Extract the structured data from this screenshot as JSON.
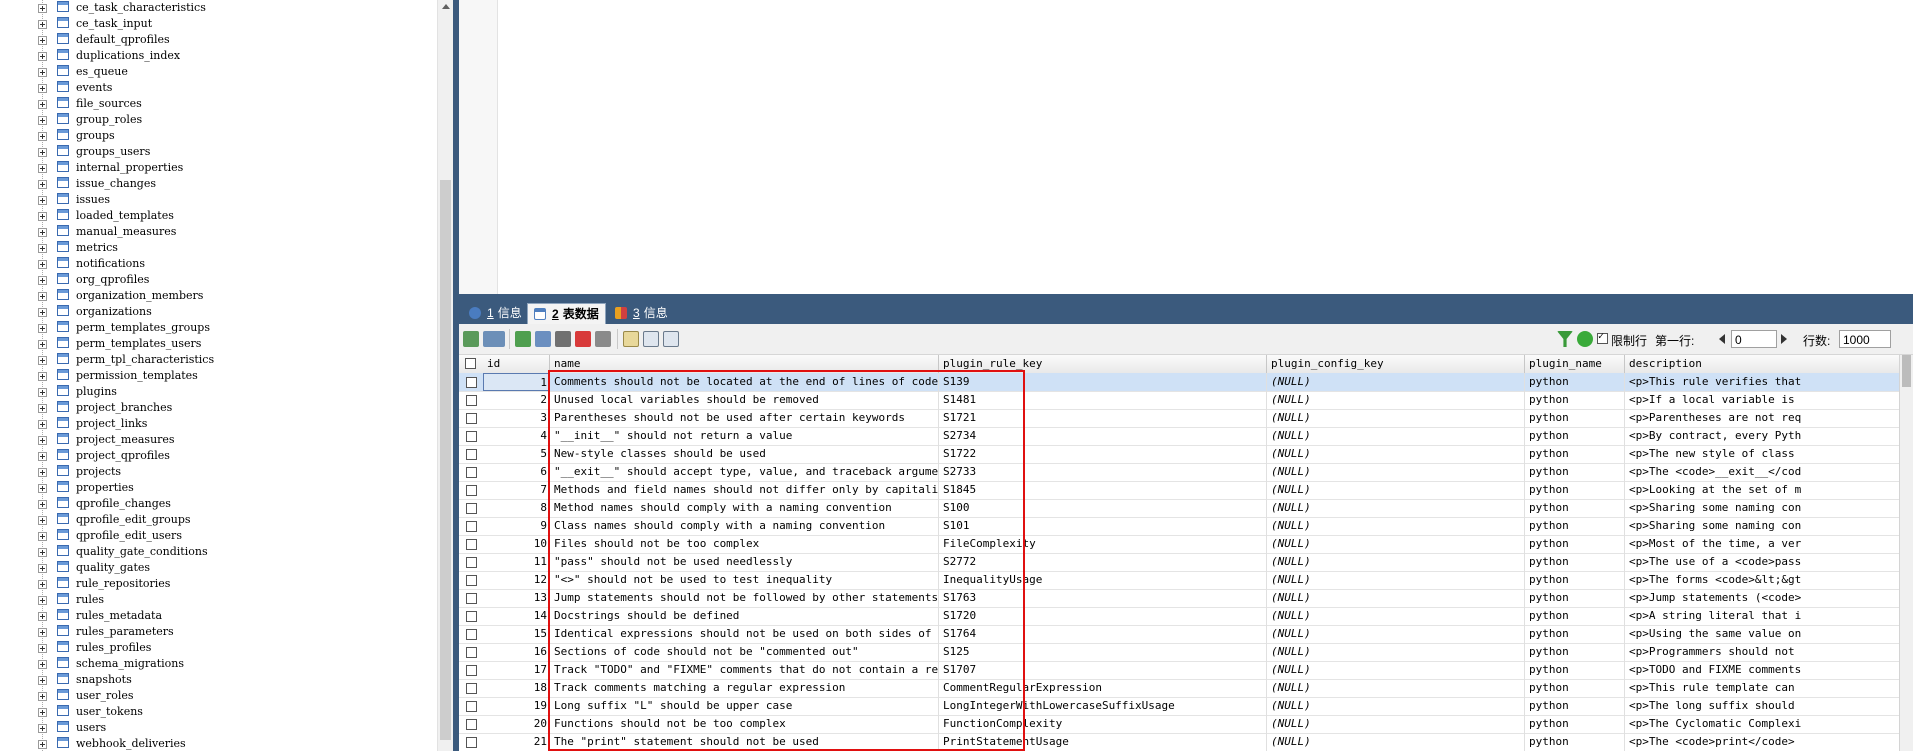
{
  "tree": {
    "items": [
      "ce_task_characteristics",
      "ce_task_input",
      "default_qprofiles",
      "duplications_index",
      "es_queue",
      "events",
      "file_sources",
      "group_roles",
      "groups",
      "groups_users",
      "internal_properties",
      "issue_changes",
      "issues",
      "loaded_templates",
      "manual_measures",
      "metrics",
      "notifications",
      "org_qprofiles",
      "organization_members",
      "organizations",
      "perm_templates_groups",
      "perm_templates_users",
      "perm_tpl_characteristics",
      "permission_templates",
      "plugins",
      "project_branches",
      "project_links",
      "project_measures",
      "project_qprofiles",
      "projects",
      "properties",
      "qprofile_changes",
      "qprofile_edit_groups",
      "qprofile_edit_users",
      "quality_gate_conditions",
      "quality_gates",
      "rule_repositories",
      "rules",
      "rules_metadata",
      "rules_parameters",
      "rules_profiles",
      "schema_migrations",
      "snapshots",
      "user_roles",
      "user_tokens",
      "users",
      "webhook_deliveries"
    ]
  },
  "tabs": [
    {
      "num": "1",
      "label": "信息",
      "active": false
    },
    {
      "num": "2",
      "label": "表数据",
      "active": true
    },
    {
      "num": "3",
      "label": "信息",
      "active": false
    }
  ],
  "toolbar": {
    "limit_label": "限制行",
    "first_row_label": "第一行:",
    "first_row_value": "0",
    "rows_label": "行数:",
    "rows_value": "1000"
  },
  "grid": {
    "columns": [
      "id",
      "name",
      "plugin_rule_key",
      "plugin_config_key",
      "plugin_name",
      "description"
    ],
    "rows": [
      {
        "id": "1",
        "name": "Comments should not be located at the end of lines of code",
        "key": "S139",
        "config": "(NULL)",
        "plugin": "python",
        "desc": "<p>This rule verifies that"
      },
      {
        "id": "2",
        "name": "Unused local variables should be removed",
        "key": "S1481",
        "config": "(NULL)",
        "plugin": "python",
        "desc": "<p>If a local variable is"
      },
      {
        "id": "3",
        "name": "Parentheses should not be used after certain keywords",
        "key": "S1721",
        "config": "(NULL)",
        "plugin": "python",
        "desc": "<p>Parentheses are not req"
      },
      {
        "id": "4",
        "name": "\"__init__\" should not return a value",
        "key": "S2734",
        "config": "(NULL)",
        "plugin": "python",
        "desc": "<p>By contract, every Pyth"
      },
      {
        "id": "5",
        "name": "New-style classes should be used",
        "key": "S1722",
        "config": "(NULL)",
        "plugin": "python",
        "desc": "<p>The new style of class"
      },
      {
        "id": "6",
        "name": "\"__exit__\" should accept type, value, and traceback arguments",
        "key": "S2733",
        "config": "(NULL)",
        "plugin": "python",
        "desc": "<p>The <code>__exit__</cod"
      },
      {
        "id": "7",
        "name": "Methods and field names should not differ only by capitalization",
        "key": "S1845",
        "config": "(NULL)",
        "plugin": "python",
        "desc": "<p>Looking at the set of m"
      },
      {
        "id": "8",
        "name": "Method names should comply with a naming convention",
        "key": "S100",
        "config": "(NULL)",
        "plugin": "python",
        "desc": "<p>Sharing some naming con"
      },
      {
        "id": "9",
        "name": "Class names should comply with a naming convention",
        "key": "S101",
        "config": "(NULL)",
        "plugin": "python",
        "desc": "<p>Sharing some naming con"
      },
      {
        "id": "10",
        "name": "Files should not be too complex",
        "key": "FileComplexity",
        "config": "(NULL)",
        "plugin": "python",
        "desc": "<p>Most of the time, a ver"
      },
      {
        "id": "11",
        "name": "\"pass\" should not be used needlessly",
        "key": "S2772",
        "config": "(NULL)",
        "plugin": "python",
        "desc": "<p>The use of a <code>pass"
      },
      {
        "id": "12",
        "name": "\"<>\" should not be used to test inequality",
        "key": "InequalityUsage",
        "config": "(NULL)",
        "plugin": "python",
        "desc": "<p>The forms <code>&lt;&gt"
      },
      {
        "id": "13",
        "name": "Jump statements should not be followed by other statements",
        "key": "S1763",
        "config": "(NULL)",
        "plugin": "python",
        "desc": "<p>Jump statements (<code>"
      },
      {
        "id": "14",
        "name": "Docstrings should be defined",
        "key": "S1720",
        "config": "(NULL)",
        "plugin": "python",
        "desc": "<p>A string literal that i"
      },
      {
        "id": "15",
        "name": "Identical expressions should not be used on both sides of a binary",
        "key": "S1764",
        "config": "(NULL)",
        "plugin": "python",
        "desc": "<p>Using the same value on"
      },
      {
        "id": "16",
        "name": "Sections of code should not be \"commented out\"",
        "key": "S125",
        "config": "(NULL)",
        "plugin": "python",
        "desc": "<p>Programmers should not"
      },
      {
        "id": "17",
        "name": "Track \"TODO\" and \"FIXME\" comments that do not contain a reference t",
        "key": "S1707",
        "config": "(NULL)",
        "plugin": "python",
        "desc": "<p>TODO and FIXME comments"
      },
      {
        "id": "18",
        "name": "Track comments matching a regular expression",
        "key": "CommentRegularExpression",
        "config": "(NULL)",
        "plugin": "python",
        "desc": "<p>This rule template can"
      },
      {
        "id": "19",
        "name": "Long suffix \"L\" should be upper case",
        "key": "LongIntegerWithLowercaseSuffixUsage",
        "config": "(NULL)",
        "plugin": "python",
        "desc": "<p>The long suffix should"
      },
      {
        "id": "20",
        "name": "Functions should not be too complex",
        "key": "FunctionComplexity",
        "config": "(NULL)",
        "plugin": "python",
        "desc": "<p>The Cyclomatic Complexi"
      },
      {
        "id": "21",
        "name": "The \"print\" statement should not be used",
        "key": "PrintStatementUsage",
        "config": "(NULL)",
        "plugin": "python",
        "desc": "<p>The <code>print</code>"
      }
    ]
  },
  "colors": {
    "frame_blue": "#3b5a7d",
    "selected_row": "#cfe1f6",
    "highlight_red": "#e01010"
  }
}
